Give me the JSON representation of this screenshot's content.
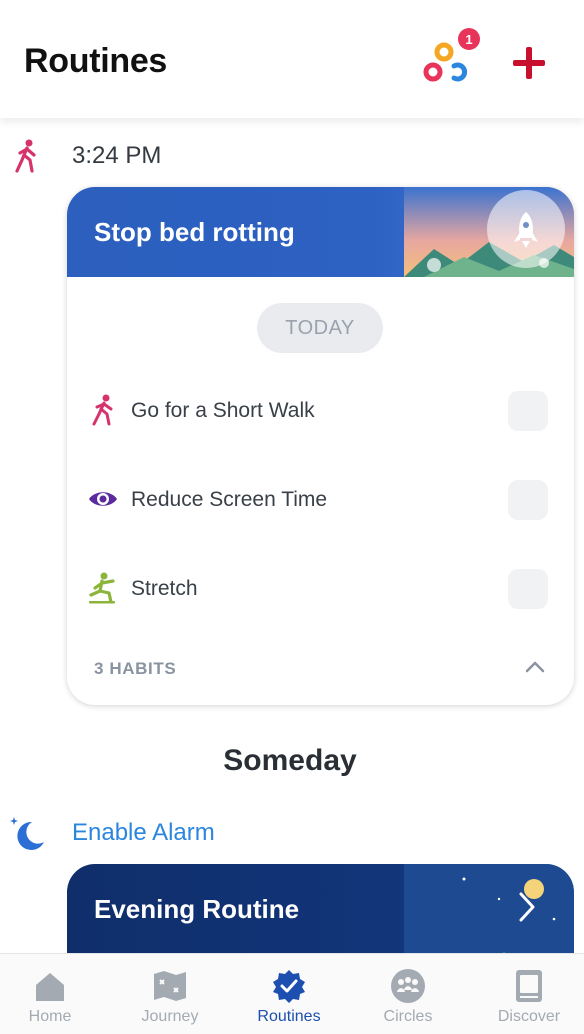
{
  "header": {
    "title": "Routines",
    "notification_count": "1"
  },
  "time_row": {
    "time": "3:24 PM"
  },
  "routine_card": {
    "title": "Stop bed rotting",
    "today_label": "TODAY",
    "habits": [
      {
        "label": "Go for a Short Walk",
        "icon": "walk-icon"
      },
      {
        "label": "Reduce Screen Time",
        "icon": "eye-icon"
      },
      {
        "label": "Stretch",
        "icon": "stretch-icon"
      }
    ],
    "habits_count": "3 HABITS"
  },
  "someday": {
    "section_title": "Someday",
    "alarm_label": "Enable Alarm",
    "card_title": "Evening Routine"
  },
  "tabbar": {
    "tabs": [
      {
        "label": "Home",
        "icon": "home-icon"
      },
      {
        "label": "Journey",
        "icon": "map-icon"
      },
      {
        "label": "Routines",
        "icon": "check-badge-icon",
        "active": true
      },
      {
        "label": "Circles",
        "icon": "people-icon"
      },
      {
        "label": "Discover",
        "icon": "book-icon"
      }
    ]
  },
  "colors": {
    "accent_blue": "#1d4fb0",
    "add_red": "#c8102e",
    "walk_pink": "#d6336c",
    "eye_purple": "#5b2a9c",
    "stretch_green": "#8bb43a",
    "alarm_blue": "#2b86de"
  }
}
